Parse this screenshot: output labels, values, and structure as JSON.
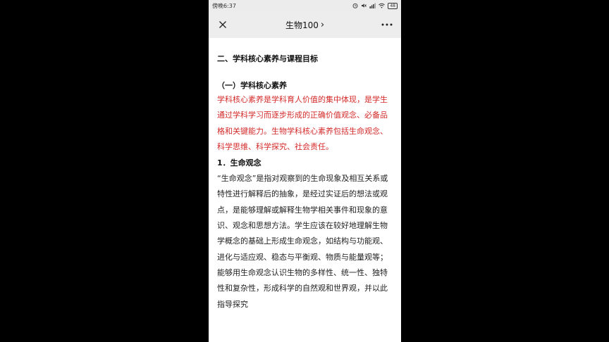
{
  "status_bar": {
    "time": "傍晚6:37",
    "battery": "48"
  },
  "nav": {
    "title": "生物100",
    "title_chevron": "›",
    "close_glyph": "✕",
    "more_glyph": "•••"
  },
  "article": {
    "section_title": "二、学科核心素养与课程目标",
    "sub_title": "（一）学科核心素养",
    "highlight_paragraph": "学科核心素养是学科育人价值的集中体现，是学生通过学科学习而逐步形成的正确价值观念、必备品格和关键能力。生物学科核心素养包括生命观念、科学思维、科学探究、社会责任。",
    "item_title": "1．生命观念",
    "body_paragraph": "“生命观念”是指对观察到的生命现象及相互关系或特性进行解释后的抽象，是经过实证后的想法或观点，是能够理解或解释生物学相关事件和现象的意识、观念和思想方法。学生应该在较好地理解生物学概念的基础上形成生命观念，如结构与功能观、进化与适应观、稳态与平衡观、物质与能量观等；能够用生命观念认识生物的多样性、统一性、独特性和复杂性，形成科学的自然观和世界观，并以此指导探究"
  },
  "colors": {
    "highlight": "#d42a2a",
    "nav_bg": "#ededed",
    "letterbox": "#000000"
  }
}
